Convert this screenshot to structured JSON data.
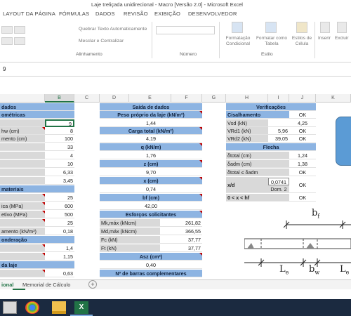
{
  "window": {
    "title": "Laje treliçada unidirecional - Macro [Versão 2.0] - Microsoft Excel"
  },
  "tabs": [
    "LAYOUT DA PÁGINA",
    "FÓRMULAS",
    "DADOS",
    "REVISÃO",
    "EXIBIÇÃO",
    "DESENVOLVEDOR"
  ],
  "ribbon": {
    "wrap_text": "Quebrar Texto Automaticamente",
    "merge_center": "Mesclar e Centralizar",
    "alignment_label": "Alinhamento",
    "number_label": "Número",
    "cond_format": [
      "Formatação",
      "Condicional"
    ],
    "format_table": [
      "Formatar como",
      "Tabela"
    ],
    "cell_styles": [
      "Estilos de",
      "Célula"
    ],
    "styles_label": "Estilo",
    "insert": "Inserir",
    "delete": "Excluir"
  },
  "formula": {
    "value": "9"
  },
  "columns": [
    "B",
    "C",
    "D",
    "E",
    "F",
    "G",
    "H",
    "I",
    "J",
    "K"
  ],
  "left": {
    "header_top": "dados",
    "geom_header": "ométricas",
    "rows": [
      {
        "label": "",
        "value": "9"
      },
      {
        "label": "hw (cm)",
        "value": "8"
      },
      {
        "label": "mento (cm)",
        "value": "100"
      },
      {
        "label": "",
        "value": "33"
      },
      {
        "label": "",
        "value": "4"
      },
      {
        "label": "",
        "value": "10"
      },
      {
        "label": "",
        "value": "6,33"
      },
      {
        "label": "",
        "value": "3,45"
      }
    ],
    "mat_header": "materiais",
    "mat_rows": [
      {
        "label": "",
        "value": "25"
      },
      {
        "label": "ica (MPa)",
        "value": "600"
      },
      {
        "label": "etivo (MPa)",
        "value": "500"
      },
      {
        "label": "",
        "value": "25"
      },
      {
        "label": "amento (kN/m³)",
        "value": "0,18"
      }
    ],
    "pond_header": "onderação",
    "pond_rows": [
      {
        "label": "",
        "value": "1,4"
      },
      {
        "label": "",
        "value": "1,15"
      }
    ],
    "laje_header": "da laje",
    "laje_rows": [
      {
        "label": "",
        "value": "0,63"
      }
    ]
  },
  "mid": {
    "header": "Saída de dados",
    "pp_label": "Peso próprio da laje (kN/m²)",
    "pp_value": "1,44",
    "ct_label": "Carga total (kN/m²)",
    "ct_value": "4,19",
    "q_label": "q (kN/m)",
    "q_value": "1,76",
    "z_label": "z (cm)",
    "z_value": "9,70",
    "x_label": "x (cm)",
    "x_value": "0,74",
    "bf_label": "bf (cm)",
    "bf_value": "42,00",
    "esf_label": "Esforços solicitantes",
    "esf_rows": [
      {
        "label": "Mk,máx (kNcm)",
        "value": "261,82"
      },
      {
        "label": "Md,máx (kNcm)",
        "value": "366,55"
      },
      {
        "label": "Fc (kN)",
        "value": "37,77"
      },
      {
        "label": "Ft (kN)",
        "value": "37,77"
      }
    ],
    "asz_label": "Asz (cm²)",
    "asz_value": "0,40",
    "nb_label": "Nº de barras complementares"
  },
  "right": {
    "header": "Verificações",
    "cis_label": "Cisalhamento",
    "cis_ok": "OK",
    "cis_rows": [
      {
        "label": "Vsd (kN)",
        "val": "",
        "res": "4,25"
      },
      {
        "label": "VRd1 (kN)",
        "val": "5,96",
        "res": "OK"
      },
      {
        "label": "VRd2 (kN)",
        "val": "39,05",
        "res": "OK"
      }
    ],
    "flecha_label": "Flecha",
    "flecha_rows": [
      {
        "label": "δtotal (cm)",
        "res": "1,24"
      },
      {
        "label": "δadm (cm)",
        "res": "1,38"
      },
      {
        "label": "δtotal ≤ δadm",
        "res": "OK"
      }
    ],
    "xd_label": "x/d",
    "xd_val": "0,0741",
    "dom": "Dom. 2",
    "xd_res": "OK",
    "xh_label": "0 < x < hf",
    "xh_res": "OK"
  },
  "diagram": {
    "bf": "b",
    "bf_sub": "f",
    "le": "L",
    "le_sub": "e",
    "bw": "b",
    "bw_sub": "w"
  },
  "sheets": [
    "ional",
    "Memorial de Cálculo"
  ],
  "colors": {
    "header_blue": "#8db4e2",
    "excel_green": "#217346",
    "flag_red": "#c00000",
    "shape_blue": "#5b9bd5"
  },
  "taskbar_icons": [
    "terminal-icon",
    "chrome-icon",
    "folder-icon",
    "excel-icon"
  ]
}
